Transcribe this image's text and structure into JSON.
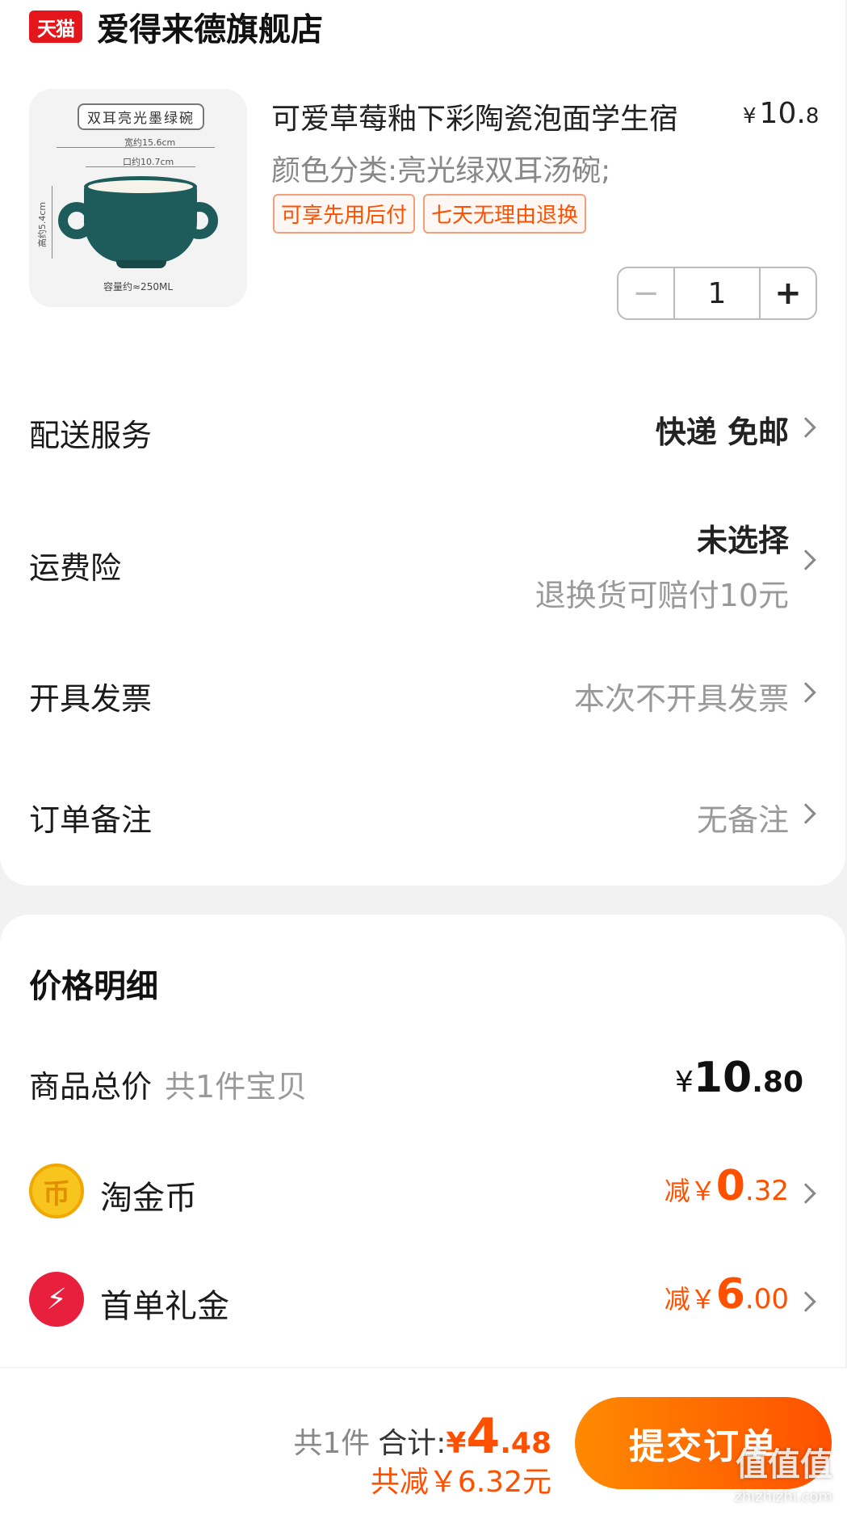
{
  "store": {
    "badge": "天猫",
    "name": "爱得来德旗舰店"
  },
  "product": {
    "image_tag": "双耳亮光墨绿碗",
    "image_dims": {
      "width": "宽约15.6cm",
      "mouth": "口约10.7cm",
      "height": "高约5.4cm",
      "capacity": "容量约≈250ML"
    },
    "title": "可爱草莓釉下彩陶瓷泡面学生宿",
    "price_yen": "¥",
    "price_int": "10.",
    "price_dec": "8",
    "spec": "颜色分类:亮光绿双耳汤碗;",
    "tags": [
      "可享先用后付",
      "七天无理由退换"
    ],
    "quantity": "1",
    "minus": "−",
    "plus": "+"
  },
  "options": {
    "delivery": {
      "label": "配送服务",
      "value": "快递 免邮"
    },
    "insurance": {
      "label": "运费险",
      "value": "未选择",
      "sub": "退换货可赔付10元"
    },
    "invoice": {
      "label": "开具发票",
      "value": "本次不开具发票"
    },
    "remark": {
      "label": "订单备注",
      "value": "无备注"
    }
  },
  "price_detail": {
    "title": "价格明细",
    "goods_total": {
      "label": "商品总价",
      "sub": "共1件宝贝",
      "yen": "¥",
      "int": "10",
      "dec": ".80"
    },
    "coins": {
      "label": "淘金币",
      "prefix": "减￥",
      "int": "0",
      "dec": ".32",
      "icon": "coin-icon",
      "icon_glyph": "币"
    },
    "first_order": {
      "label": "首单礼金",
      "prefix": "减￥",
      "int": "6",
      "dec": ".00",
      "icon": "lightning-icon",
      "icon_glyph": "⚡"
    }
  },
  "bottom_bar": {
    "count": "共1件",
    "total_label": "合计:",
    "total_yen": "¥",
    "total_int": "4",
    "total_dec": ".48",
    "saved": "共减￥6.32元",
    "submit": "提交订单"
  },
  "watermark": {
    "text": "值值值",
    "url": "zhizhizhi.com"
  },
  "colors": {
    "accent": "#ff5000",
    "tmall_red": "#e4161c"
  }
}
